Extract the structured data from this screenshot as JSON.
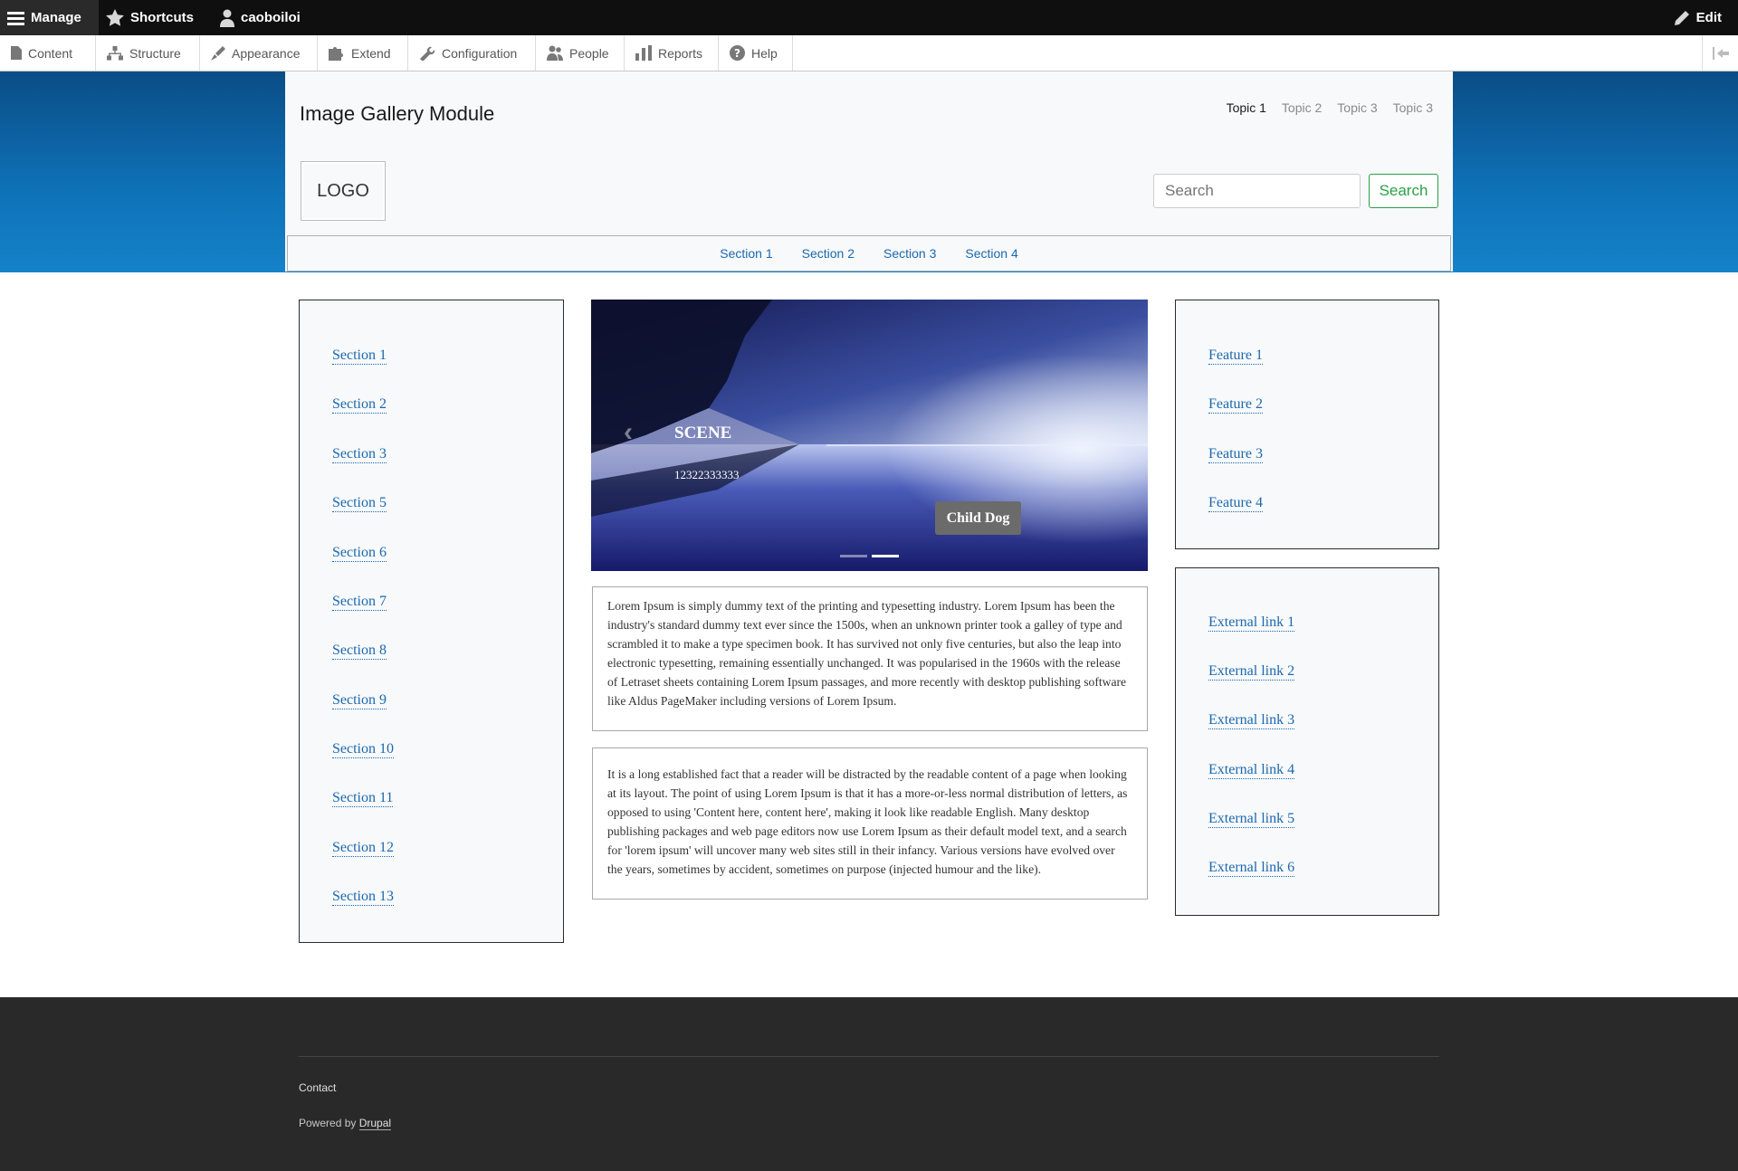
{
  "admin_bar": {
    "manage": "Manage",
    "shortcuts": "Shortcuts",
    "user": "caoboiloi",
    "edit": "Edit"
  },
  "admin_tray": {
    "items": [
      "Content",
      "Structure",
      "Appearance",
      "Extend",
      "Configuration",
      "People",
      "Reports",
      "Help"
    ]
  },
  "header": {
    "site_name": "Image Gallery Module",
    "topics": [
      "Topic 1",
      "Topic 2",
      "Topic 3",
      "Topic 3"
    ],
    "logo": "LOGO",
    "search": {
      "placeholder": "Search",
      "button": "Search"
    },
    "sections": [
      "Section 1",
      "Section 2",
      "Section 3",
      "Section 4"
    ]
  },
  "left_sidebar": {
    "links": [
      "Section 1",
      "Section 2",
      "Section 3",
      "Section 5",
      "Section 6",
      "Section 7",
      "Section 8",
      "Section 9",
      "Section 10",
      "Section 11",
      "Section 12",
      "Section 13"
    ]
  },
  "carousel": {
    "title": "SCENE",
    "subtitle": "12322333333",
    "badge": "Child Dog",
    "prev_glyph": "‹"
  },
  "content": {
    "paragraph_1": "Lorem Ipsum is simply dummy text of the printing and typesetting industry. Lorem Ipsum has been the industry's standard dummy text ever since the 1500s, when an unknown printer took a galley of type and scrambled it to make a type specimen book. It has survived not only five centuries, but also the leap into electronic typesetting, remaining essentially unchanged. It was popularised in the 1960s with the release of Letraset sheets containing Lorem Ipsum passages, and more recently with desktop publishing software like Aldus PageMaker including versions of Lorem Ipsum.",
    "paragraph_2": "It is a long established fact that a reader will be distracted by the readable content of a page when looking at its layout. The point of using Lorem Ipsum is that it has a more-or-less normal distribution of letters, as opposed to using 'Content here, content here', making it look like readable English. Many desktop publishing packages and web page editors now use Lorem Ipsum as their default model text, and a search for 'lorem ipsum' will uncover many web sites still in their infancy. Various versions have evolved over the years, sometimes by accident, sometimes on purpose (injected humour and the like)."
  },
  "right_sidebar": {
    "features": [
      "Feature 1",
      "Feature 2",
      "Feature 3",
      "Feature 4"
    ],
    "external_links": [
      "External link 1",
      "External link 2",
      "External link 3",
      "External link 4",
      "External link 5",
      "External link 6"
    ]
  },
  "footer": {
    "contact": "Contact",
    "powered_by": "Powered by",
    "drupal": "Drupal"
  },
  "colors": {
    "link": "#1c68ad",
    "search_button": "#2aa146",
    "header_blue": "#0f72b8",
    "footer_bg": "#292929"
  }
}
